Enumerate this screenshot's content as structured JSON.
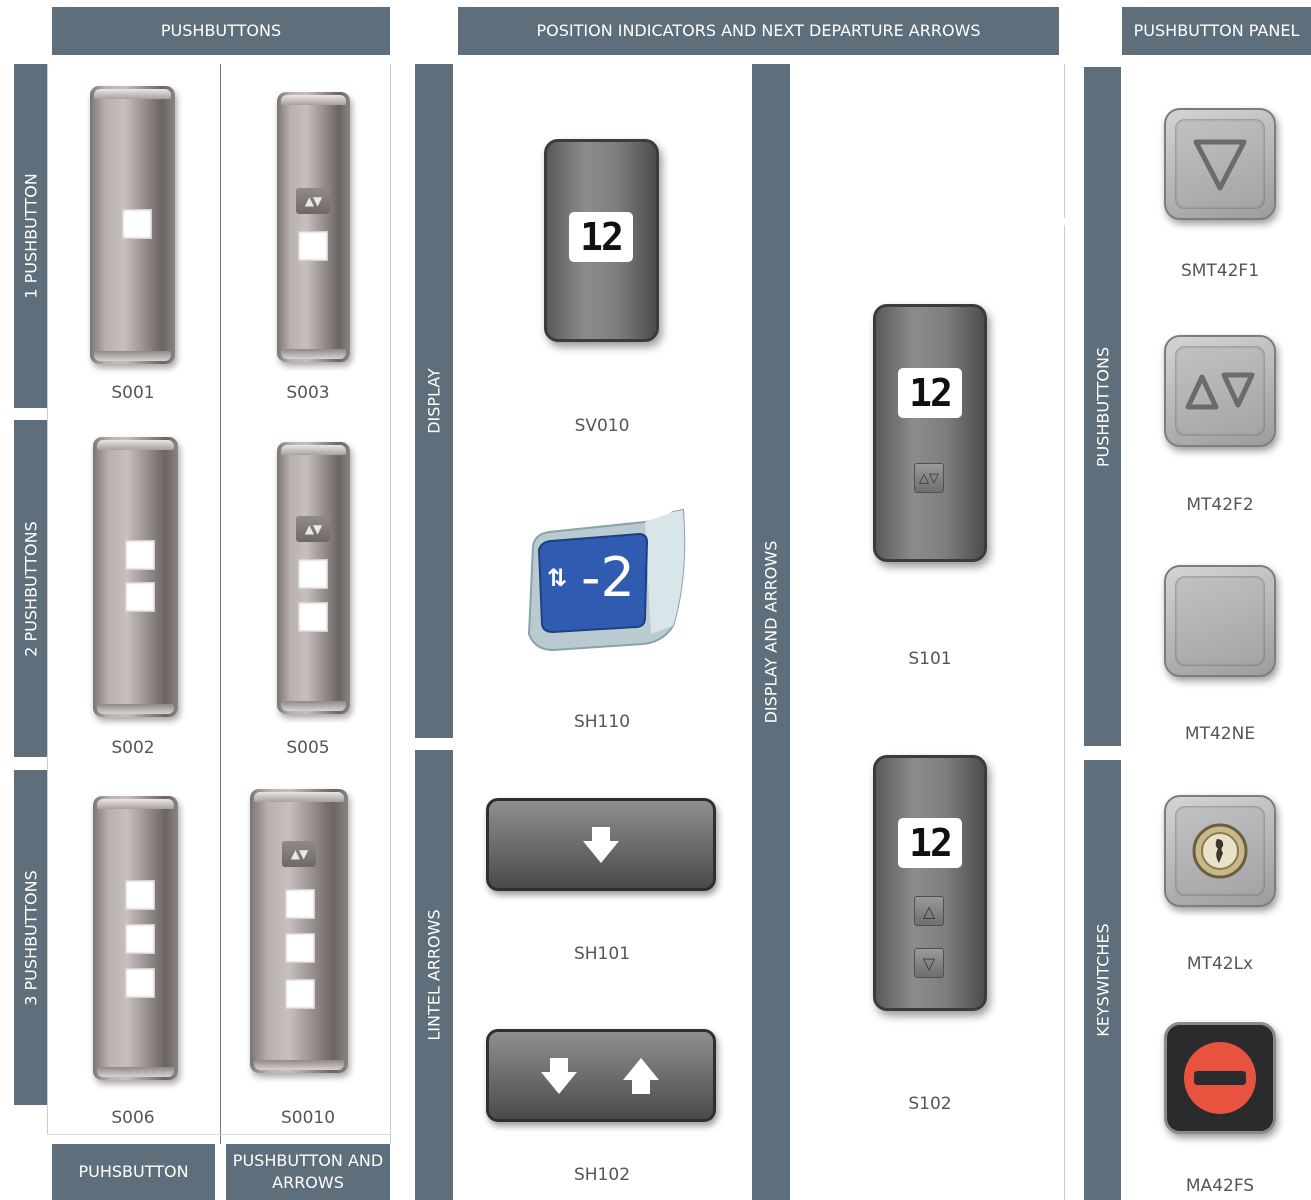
{
  "headers": {
    "pushbuttons": "PUSHBUTTONS",
    "position_indicators": "POSITION INDICATORS AND NEXT DEPARTURE ARROWS",
    "pushbutton_panel": "PUSHBUTTON PANEL"
  },
  "footers": {
    "puhsbutton": "PUHSBUTTON",
    "pushbutton_and_arrows_1": "PUSHBUTTON AND",
    "pushbutton_and_arrows_2": "ARROWS"
  },
  "side_labels": {
    "one_pushbutton": "1 PUSHBUTTON",
    "two_pushbuttons": "2 PUSHBUTTONS",
    "three_pushbuttons": "3 PUSHBUTTONS",
    "display": "DISPLAY",
    "lintel_arrows": "LINTEL ARROWS",
    "display_and_arrows": "DISPLAY AND ARROWS",
    "panel_pushbuttons": "PUSHBUTTONS",
    "keyswitches": "KEYSWITCHES"
  },
  "products": {
    "s001": "S001",
    "s003": "S003",
    "s002": "S002",
    "s005": "S005",
    "s006": "S006",
    "s0010": "S0010",
    "sv010": "SV010",
    "sh110": "SH110",
    "sh101": "SH101",
    "sh102": "SH102",
    "s101": "S101",
    "s102": "S102",
    "smt42f1": "SMT42F1",
    "mt42f2": "MT42F2",
    "mt42ne": "MT42NE",
    "mt42lx": "MT42Lx",
    "ma42fs": "MA42FS"
  },
  "display_values": {
    "sv010": "12",
    "sh110": "-2",
    "s101": "12",
    "s102": "12"
  },
  "icons": {
    "up_down": "up-down-arrows-icon",
    "down": "down-arrow-icon",
    "up": "up-arrow-icon",
    "key": "key-icon",
    "no_entry": "no-entry-icon"
  },
  "colors": {
    "header_bg": "#5e6e7b",
    "display_blue": "#2f5bb0",
    "stop_red": "#e8533f"
  }
}
